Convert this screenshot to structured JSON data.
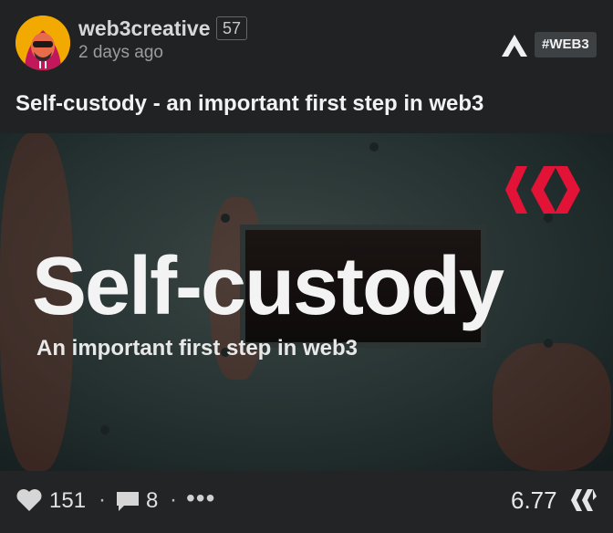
{
  "author": {
    "username": "web3creative",
    "reputation": "57",
    "time": "2 days ago"
  },
  "post": {
    "tag": "#WEB3",
    "title": "Self-custody - an important first step in web3"
  },
  "image": {
    "heading": "Self-custody",
    "subheading": "An important first step in web3"
  },
  "stats": {
    "votes": "151",
    "comments": "8",
    "more": "•••",
    "payout": "6.77"
  },
  "icons": {
    "avatar": "avatar-hooded-figure",
    "app": "app-logo-icon",
    "heart": "heart-icon",
    "comment": "comment-icon",
    "hive": "hive-icon"
  },
  "colors": {
    "background": "#1d1f21",
    "hive_red": "#e31337",
    "avatar_bg": "#f2a900"
  }
}
